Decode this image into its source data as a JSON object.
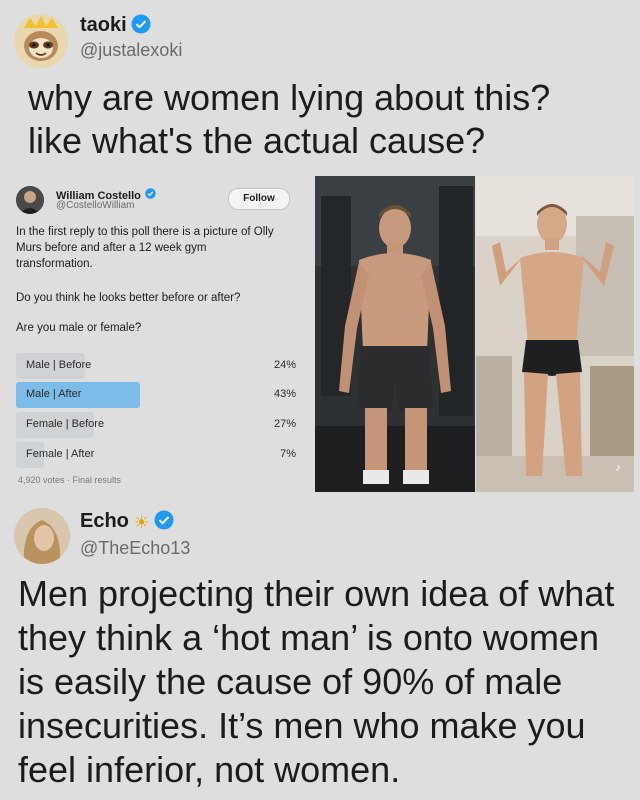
{
  "tweet1": {
    "name": "taoki",
    "handle": "@justalexoki",
    "text_line1": "why are women lying about this?",
    "text_line2": "like what's the actual cause?"
  },
  "quoted": {
    "name": "William Costello",
    "handle": "@CostelloWilliam",
    "follow_label": "Follow",
    "text1": "In the first reply to this poll there is a picture of Olly Murs before and after a 12 week gym transformation.",
    "text2": "Do you think he looks better before or after?",
    "text3": "Are you male or female?",
    "poll": [
      {
        "label": "Male | Before",
        "percent_text": "24%",
        "percent": 24,
        "leading": false
      },
      {
        "label": "Male | After",
        "percent_text": "43%",
        "percent": 43,
        "leading": true
      },
      {
        "label": "Female | Before",
        "percent_text": "27%",
        "percent": 27,
        "leading": false
      },
      {
        "label": "Female | After",
        "percent_text": "7%",
        "percent": 7,
        "leading": false
      }
    ],
    "footer": "4,920 votes · Final results"
  },
  "tweet2": {
    "name": "Echo",
    "handle": "@TheEcho13",
    "text_lines": [
      "Men projecting their own idea of what",
      "they think a ‘hot man’ is onto women",
      "is easily the cause of 90% of male",
      "insecurities. It’s men who make you",
      "feel inferior, not women."
    ]
  },
  "colors": {
    "verified": "#1d9bf0",
    "poll_leading": "#7dbbe9",
    "poll_other": "#d0d3d6"
  },
  "icons": [
    "verified-badge-icon",
    "sun-icon",
    "tiktok-icon"
  ]
}
